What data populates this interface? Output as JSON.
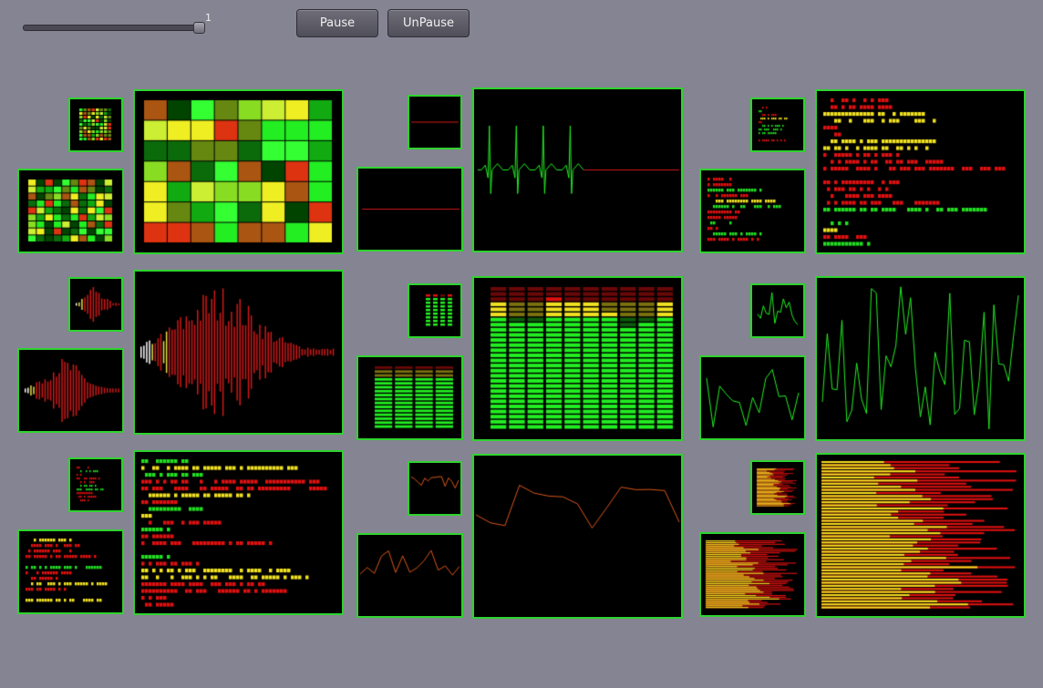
{
  "controls": {
    "slider_value": "1",
    "slider_fraction": 1.0,
    "pause_label": "Pause",
    "unpause_label": "UnPause"
  },
  "panels": [
    {
      "name": "heatmap",
      "type": "heatmap"
    },
    {
      "name": "ecg",
      "type": "ecg"
    },
    {
      "name": "log-text-b",
      "type": "text"
    },
    {
      "name": "waveform",
      "type": "wave"
    },
    {
      "name": "equalizer",
      "type": "eq"
    },
    {
      "name": "green-line",
      "type": "gline"
    },
    {
      "name": "log-text-a",
      "type": "text"
    },
    {
      "name": "orange-line",
      "type": "oline"
    },
    {
      "name": "hbars",
      "type": "hbars"
    }
  ],
  "colors": {
    "border": "#2fd32f",
    "green": "#22ee22",
    "red": "#e01010",
    "yellow": "#f4e020"
  }
}
